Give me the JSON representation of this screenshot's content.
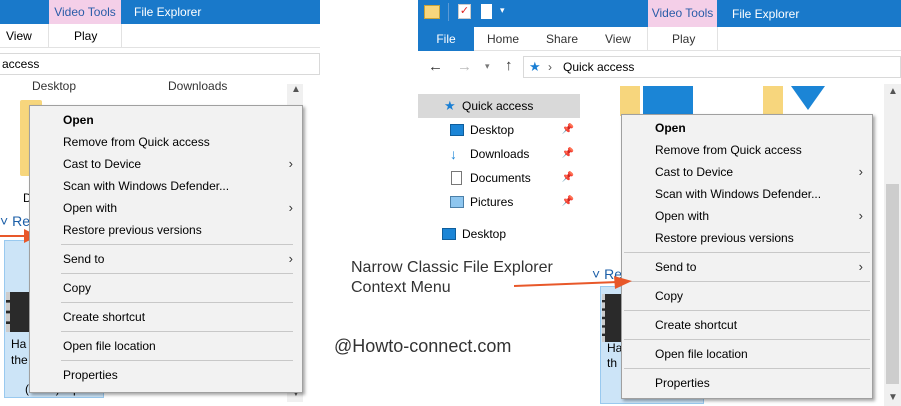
{
  "left_window": {
    "contextual_tab": "Video Tools",
    "title": "File Explorer",
    "ribbon_tabs": [
      "View",
      "Play"
    ],
    "address_text": "access",
    "items": [
      "Desktop",
      "Downloads"
    ],
    "partial_d": "D",
    "recent_group": "Re",
    "file_name_partial": [
      "Ha",
      "the",
      "(2002).mp4"
    ]
  },
  "right_window": {
    "contextual_tab": "Video Tools",
    "title": "File Explorer",
    "ribbon_tabs": [
      "File",
      "Home",
      "Share",
      "View",
      "Play"
    ],
    "address_separator": "›",
    "address_text": "Quick access",
    "nav_items": [
      {
        "label": "Quick access",
        "icon": "star-icon",
        "selected": true,
        "pinned": false
      },
      {
        "label": "Desktop",
        "icon": "desktop-icon",
        "selected": false,
        "pinned": true
      },
      {
        "label": "Downloads",
        "icon": "download-icon",
        "selected": false,
        "pinned": true
      },
      {
        "label": "Documents",
        "icon": "document-icon",
        "selected": false,
        "pinned": true
      },
      {
        "label": "Pictures",
        "icon": "pictures-icon",
        "selected": false,
        "pinned": true
      },
      {
        "label": "Desktop",
        "icon": "desktop-icon",
        "selected": false,
        "pinned": false
      }
    ],
    "recent_group": "Re",
    "file_name_partial": [
      "Ha",
      "th"
    ]
  },
  "context_menu": {
    "items": [
      {
        "label": "Open",
        "bold": true,
        "submenu": false
      },
      {
        "label": "Remove from Quick access",
        "bold": false,
        "submenu": false
      },
      {
        "label": "Cast to Device",
        "bold": false,
        "submenu": true
      },
      {
        "label": "Scan with Windows Defender...",
        "bold": false,
        "submenu": false
      },
      {
        "label": "Open with",
        "bold": false,
        "submenu": true
      },
      {
        "label": "Restore previous versions",
        "bold": false,
        "submenu": false
      },
      {
        "label": "Send to",
        "bold": false,
        "submenu": true
      },
      {
        "label": "Copy",
        "bold": false,
        "submenu": false
      },
      {
        "label": "Create shortcut",
        "bold": false,
        "submenu": false
      },
      {
        "label": "Open file location",
        "bold": false,
        "submenu": false
      },
      {
        "label": "Properties",
        "bold": false,
        "submenu": false
      }
    ],
    "submenu_glyph": "›"
  },
  "annotation": {
    "caption_line1": "Narrow Classic File Explorer",
    "caption_line2": "Context Menu",
    "watermark": "@Howto-connect.com"
  },
  "colors": {
    "titlebar": "#1979ca",
    "contextual_tab_bg": "#f4cfe8",
    "arrow": "#e8582a",
    "selection": "#cce4f7"
  }
}
